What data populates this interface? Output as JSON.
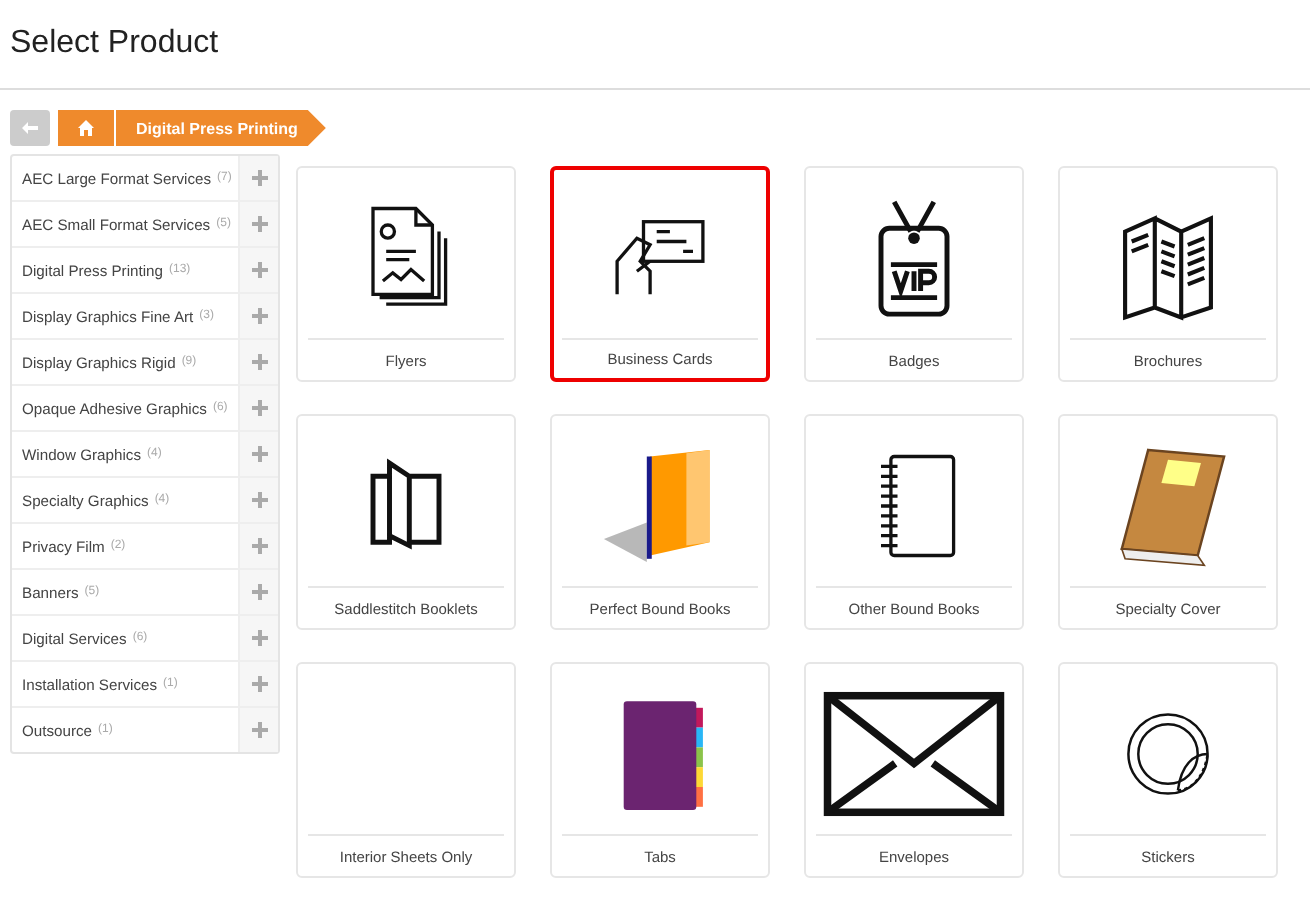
{
  "page_title": "Select Product",
  "breadcrumb": {
    "current": "Digital Press Printing"
  },
  "categories": [
    {
      "name": "AEC Large Format Services",
      "count": "(7)"
    },
    {
      "name": "AEC Small Format Services",
      "count": "(5)"
    },
    {
      "name": "Digital Press Printing",
      "count": "(13)"
    },
    {
      "name": "Display Graphics Fine Art",
      "count": "(3)"
    },
    {
      "name": "Display Graphics Rigid",
      "count": "(9)"
    },
    {
      "name": "Opaque Adhesive Graphics",
      "count": "(6)"
    },
    {
      "name": "Window Graphics",
      "count": "(4)"
    },
    {
      "name": "Specialty Graphics",
      "count": "(4)"
    },
    {
      "name": "Privacy Film",
      "count": "(2)"
    },
    {
      "name": "Banners",
      "count": "(5)"
    },
    {
      "name": "Digital Services",
      "count": "(6)"
    },
    {
      "name": "Installation Services",
      "count": "(1)"
    },
    {
      "name": "Outsource",
      "count": "(1)"
    }
  ],
  "products": [
    {
      "name": "Flyers",
      "kind": "flyer",
      "selected": false
    },
    {
      "name": "Business Cards",
      "kind": "card",
      "selected": true
    },
    {
      "name": "Badges",
      "kind": "badge",
      "selected": false
    },
    {
      "name": "Brochures",
      "kind": "brochure",
      "selected": false
    },
    {
      "name": "Saddlestitch Booklets",
      "kind": "booklet",
      "selected": false
    },
    {
      "name": "Perfect Bound Books",
      "kind": "orangebook",
      "selected": false
    },
    {
      "name": "Other Bound Books",
      "kind": "notebook",
      "selected": false
    },
    {
      "name": "Specialty Cover",
      "kind": "brownbook",
      "selected": false
    },
    {
      "name": "Interior Sheets Only",
      "kind": "none",
      "selected": false
    },
    {
      "name": "Tabs",
      "kind": "tabs",
      "selected": false
    },
    {
      "name": "Envelopes",
      "kind": "envelope",
      "selected": false
    },
    {
      "name": "Stickers",
      "kind": "sticker",
      "selected": false
    }
  ]
}
